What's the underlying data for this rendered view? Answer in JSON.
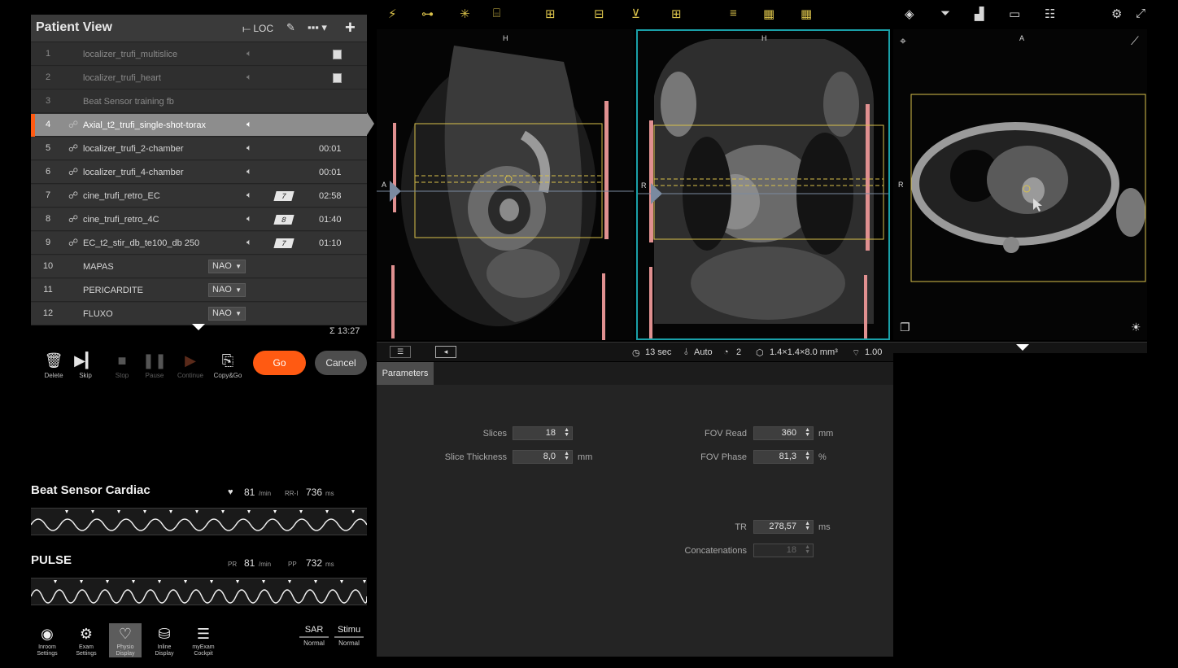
{
  "patient_view": {
    "title": "Patient View",
    "loc_label": "LOC",
    "rows": [
      {
        "num": "1",
        "name": "localizer_trufi_multislice",
        "time": ""
      },
      {
        "num": "2",
        "name": "localizer_trufi_heart",
        "time": ""
      },
      {
        "num": "3",
        "name": "Beat Sensor training fb",
        "time": ""
      },
      {
        "num": "4",
        "name": "Axial_t2_trufi_single-shot-torax",
        "time": ""
      },
      {
        "num": "5",
        "name": "localizer_trufi_2-chamber",
        "time": "00:01"
      },
      {
        "num": "6",
        "name": "localizer_trufi_4-chamber",
        "time": "00:01"
      },
      {
        "num": "7",
        "name": "cine_trufi_retro_EC",
        "badge": "7",
        "time": "02:58"
      },
      {
        "num": "8",
        "name": "cine_trufi_retro_4C",
        "badge": "8",
        "time": "01:40"
      },
      {
        "num": "9",
        "name": "EC_t2_stir_db_te100_db 250",
        "badge": "7",
        "time": "01:10"
      },
      {
        "num": "10",
        "name": "MAPAS",
        "dropdown": "NAO"
      },
      {
        "num": "11",
        "name": "PERICARDITE",
        "dropdown": "NAO"
      },
      {
        "num": "12",
        "name": "FLUXO",
        "dropdown": "NAO"
      }
    ],
    "total_time": "Σ 13:27"
  },
  "controls": {
    "delete": "Delete",
    "skip": "Skip",
    "stop": "Stop",
    "pause": "Pause",
    "continue": "Continue",
    "copy_go": "Copy&Go",
    "go": "Go",
    "cancel": "Cancel"
  },
  "physio": {
    "beat": {
      "title": "Beat Sensor Cardiac",
      "hr": "81",
      "hr_unit": "/min",
      "rr_label": "RR-I",
      "rr": "736",
      "rr_unit": "ms"
    },
    "pulse": {
      "title": "PULSE",
      "pr_label": "PR",
      "pr": "81",
      "pr_unit": "/min",
      "pp_label": "PP",
      "pp": "732",
      "pp_unit": "ms"
    }
  },
  "bottom_bar": {
    "inroom": "Inroom Settings",
    "exam": "Exam Settings",
    "physio": "Physio Display",
    "inline": "Inline Display",
    "cockpit": "myExam Cockpit",
    "sar_label": "SAR",
    "sar_value": "Normal",
    "stim_label": "Stimu",
    "stim_value": "Normal"
  },
  "viewports": {
    "v1": {
      "top": "H",
      "left": "A"
    },
    "v2": {
      "top": "H",
      "left": "R"
    },
    "v3": {
      "top": "A",
      "left": "R"
    }
  },
  "status": {
    "time": "13 sec",
    "mode": "Auto",
    "count": "2",
    "voxel": "1.4×1.4×8.0 mm³",
    "snr": "1.00"
  },
  "parameters": {
    "tab": "Parameters",
    "slices_label": "Slices",
    "slices": "18",
    "thickness_label": "Slice Thickness",
    "thickness": "8,0",
    "thickness_unit": "mm",
    "fov_read_label": "FOV Read",
    "fov_read": "360",
    "fov_read_unit": "mm",
    "fov_phase_label": "FOV Phase",
    "fov_phase": "81,3",
    "fov_phase_unit": "%",
    "tr_label": "TR",
    "tr": "278,57",
    "tr_unit": "ms",
    "concat_label": "Concatenations",
    "concat": "18"
  },
  "colors": {
    "accent": "#ff5a12",
    "selection_cyan": "#1aa0a8",
    "slab_yellow": "#d9c14a"
  }
}
